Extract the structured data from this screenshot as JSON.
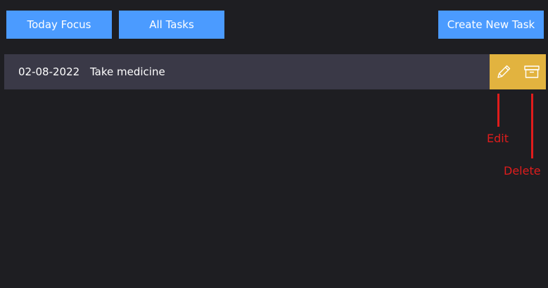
{
  "toolbar": {
    "today_focus_label": "Today Focus",
    "all_tasks_label": "All Tasks",
    "create_new_task_label": "Create New Task"
  },
  "task": {
    "date": "02-08-2022",
    "title": "Take medicine",
    "edit_icon": "pencil-icon",
    "delete_icon": "archive-box-icon"
  },
  "annotations": {
    "edit_label": "Edit",
    "delete_label": "Delete"
  },
  "colors": {
    "background": "#1e1e22",
    "button": "#4b9bff",
    "task_row": "#3a3947",
    "action_accent": "#e2b33f",
    "annotation": "#e01c1c"
  }
}
